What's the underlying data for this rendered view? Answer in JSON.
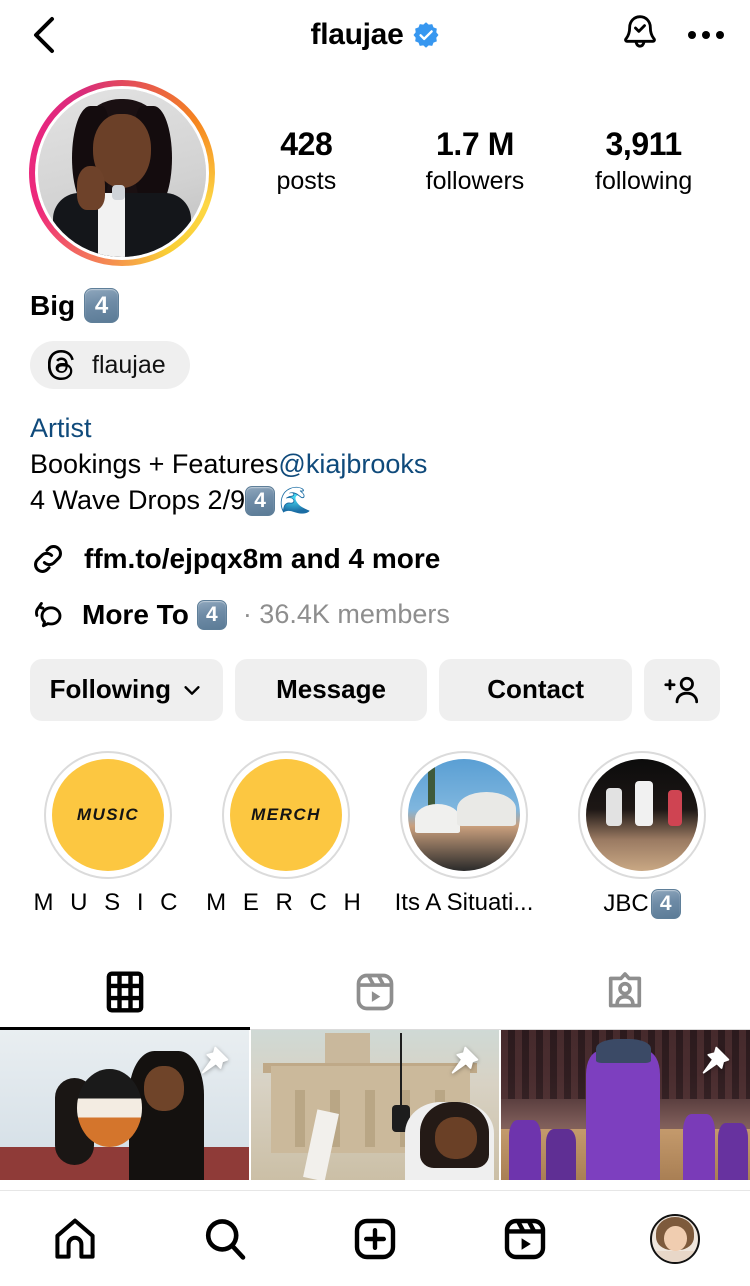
{
  "header": {
    "username": "flaujae",
    "verified": true,
    "back_icon": "chevron-left-icon",
    "notifications_icon": "bell-icon",
    "more_icon": "more-options-icon"
  },
  "profile": {
    "avatar_alt": "flaujae profile photo",
    "has_story_ring": true,
    "stats": [
      {
        "value": "428",
        "label": "posts"
      },
      {
        "value": "1.7 M",
        "label": "followers"
      },
      {
        "value": "3,911",
        "label": "following"
      }
    ],
    "display_name": "Big",
    "display_name_emoji": "4",
    "threads_handle": "flaujae",
    "category": "Artist",
    "bio_line_1_text": "Bookings + Features ",
    "bio_line_1_mention": "@kiajbrooks",
    "bio_line_2_text": "4 Wave Drops 2/9 ",
    "bio_line_2_emoji": "4",
    "bio_line_2_wave": "🌊",
    "link_text": "ffm.to/ejpqx8m and 4 more",
    "channel_name": "More To",
    "channel_emoji": "4",
    "channel_meta": "· 36.4K members"
  },
  "actions": [
    {
      "label": "Following",
      "icon": "chevron-down-icon",
      "name": "following-button"
    },
    {
      "label": "Message",
      "icon": "",
      "name": "message-button"
    },
    {
      "label": "Contact",
      "icon": "",
      "name": "contact-button"
    },
    {
      "label": "",
      "icon": "add-person-icon",
      "name": "add-person-button"
    }
  ],
  "highlights": [
    {
      "label": "M U S I C",
      "cover_word": "MUSIC",
      "style": "yellow"
    },
    {
      "label": "M E R C H",
      "cover_word": "MERCH",
      "style": "yellow"
    },
    {
      "label": "Its A Situati...",
      "cover_word": "",
      "style": "photo-beach"
    },
    {
      "label": "JBC",
      "label_emoji": "4",
      "cover_word": "",
      "style": "photo-court"
    }
  ],
  "tabs": [
    {
      "name": "grid",
      "icon": "grid-icon",
      "active": true
    },
    {
      "name": "reels",
      "icon": "reels-icon",
      "active": false
    },
    {
      "name": "tagged",
      "icon": "tagged-icon",
      "active": false
    }
  ],
  "grid_posts": [
    {
      "alt": "holding basketball",
      "pinned": true
    },
    {
      "alt": "singing in front of memorial tower",
      "pinned": true
    },
    {
      "alt": "basketball arena celebration",
      "pinned": true
    }
  ],
  "bottom_nav": [
    {
      "name": "home",
      "icon": "home-icon"
    },
    {
      "name": "search",
      "icon": "search-icon"
    },
    {
      "name": "create",
      "icon": "plus-square-icon"
    },
    {
      "name": "reels",
      "icon": "reels-icon"
    },
    {
      "name": "profile",
      "icon": "profile-avatar"
    }
  ],
  "colors": {
    "verified_blue": "#3797F0",
    "link_blue": "#0f4a7b",
    "button_gray": "#efefef",
    "meta_gray": "#8e8e8e",
    "highlight_yellow": "#FCC741"
  }
}
